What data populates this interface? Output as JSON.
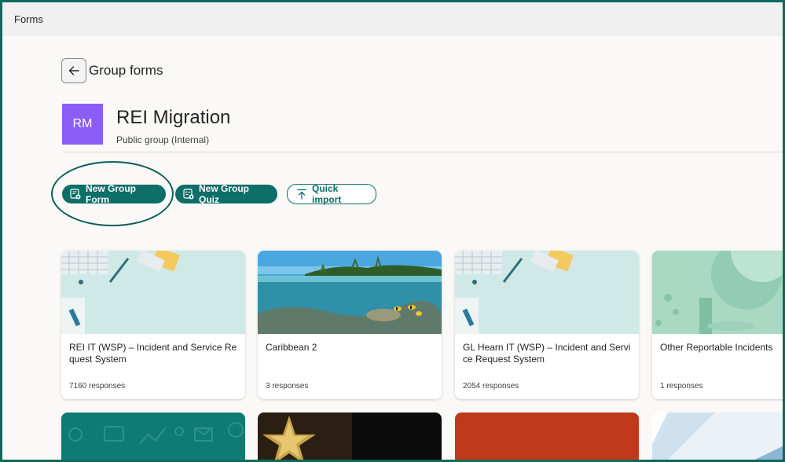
{
  "app": {
    "title": "Forms"
  },
  "header": {
    "back_label": "Group forms"
  },
  "group": {
    "initials": "RM",
    "name": "REI Migration",
    "subtitle": "Public group (Internal)"
  },
  "actions": {
    "new_form": "New Group Form",
    "new_quiz": "New Group Quiz",
    "quick_import": "Quick import"
  },
  "forms": [
    {
      "title": "REI IT (WSP) – Incident and Service Request System",
      "responses": "7160 responses",
      "theme": "desk-teal"
    },
    {
      "title": "Caribbean 2",
      "responses": "3 responses",
      "theme": "ocean"
    },
    {
      "title": "GL Hearn IT (WSP) – Incident and Service Request System",
      "responses": "2054 responses",
      "theme": "desk-teal"
    },
    {
      "title": "Other Reportable Incidents",
      "responses": "1 responses",
      "theme": "mint-geometric"
    }
  ],
  "forms_row2_themes": [
    "teal-icons",
    "gold-star",
    "rust",
    "blue-glass"
  ],
  "colors": {
    "accent": "#0e6e68",
    "avatar": "#8b5cf6",
    "frame": "#0b6a5c"
  }
}
